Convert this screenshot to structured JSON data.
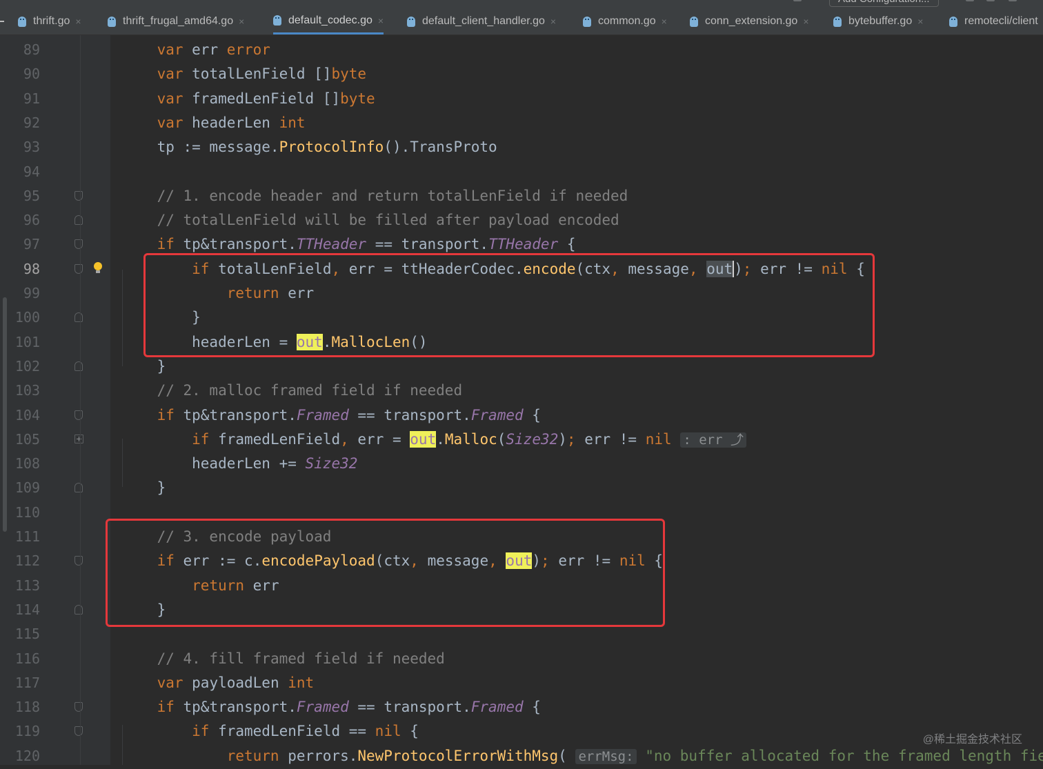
{
  "toolbar": {
    "run_config_label": "Add Configuration..."
  },
  "tabs": [
    {
      "label": "thrift.go",
      "active": false,
      "icon": "go-file-icon"
    },
    {
      "label": "thrift_frugal_amd64.go",
      "active": false,
      "icon": "go-file-icon"
    },
    {
      "label": "default_codec.go",
      "active": true,
      "icon": "go-file-icon"
    },
    {
      "label": "default_client_handler.go",
      "active": false,
      "icon": "go-file-icon"
    },
    {
      "label": "common.go",
      "active": false,
      "icon": "go-file-icon"
    },
    {
      "label": "conn_extension.go",
      "active": false,
      "icon": "go-file-icon"
    },
    {
      "label": "bytebuffer.go",
      "active": false,
      "icon": "go-file-icon"
    },
    {
      "label": "remotecli/client",
      "active": false,
      "icon": "go-file-icon"
    }
  ],
  "tab_close_glyph": "×",
  "editor": {
    "current_line": "98",
    "lines": [
      {
        "n": "89",
        "fold": "",
        "tokens": [
          [
            "",
            "    "
          ],
          [
            "kw",
            "var"
          ],
          [
            "",
            " err "
          ],
          [
            "ty",
            "error"
          ]
        ]
      },
      {
        "n": "90",
        "fold": "",
        "tokens": [
          [
            "",
            "    "
          ],
          [
            "kw",
            "var"
          ],
          [
            "",
            " totalLenField []"
          ],
          [
            "ty",
            "byte"
          ]
        ]
      },
      {
        "n": "91",
        "fold": "",
        "tokens": [
          [
            "",
            "    "
          ],
          [
            "kw",
            "var"
          ],
          [
            "",
            " framedLenField []"
          ],
          [
            "ty",
            "byte"
          ]
        ]
      },
      {
        "n": "92",
        "fold": "",
        "tokens": [
          [
            "",
            "    "
          ],
          [
            "kw",
            "var"
          ],
          [
            "",
            " headerLen "
          ],
          [
            "ty",
            "int"
          ]
        ]
      },
      {
        "n": "93",
        "fold": "",
        "tokens": [
          [
            "",
            "    tp := message."
          ],
          [
            "mt",
            "ProtocolInfo"
          ],
          [
            "",
            "().TransProto"
          ]
        ]
      },
      {
        "n": "94",
        "fold": "",
        "tokens": []
      },
      {
        "n": "95",
        "fold": "open",
        "tokens": [
          [
            "",
            "    "
          ],
          [
            "cm",
            "// 1. encode header and return totalLenField if needed"
          ]
        ]
      },
      {
        "n": "96",
        "fold": "close",
        "tokens": [
          [
            "",
            "    "
          ],
          [
            "cm",
            "// totalLenField will be filled after payload encoded"
          ]
        ]
      },
      {
        "n": "97",
        "fold": "open",
        "tokens": [
          [
            "",
            "    "
          ],
          [
            "kw",
            "if"
          ],
          [
            "",
            " tp&transport."
          ],
          [
            "it",
            "TTHeader"
          ],
          [
            "",
            " == transport."
          ],
          [
            "it",
            "TTHeader"
          ],
          [
            "",
            " {"
          ]
        ]
      },
      {
        "n": "98",
        "fold": "open",
        "bulb": true,
        "tokens": [
          [
            "",
            "        "
          ],
          [
            "kw",
            "if"
          ],
          [
            "",
            " totalLenField"
          ],
          [
            "kw",
            ","
          ],
          [
            "",
            " err = ttHeaderCodec."
          ],
          [
            "mt",
            "encode"
          ],
          [
            "",
            "(ctx"
          ],
          [
            "kw",
            ","
          ],
          [
            "",
            " message"
          ],
          [
            "kw",
            ","
          ],
          [
            "",
            " "
          ],
          [
            "sel",
            "out"
          ],
          [
            "caret",
            ")"
          ],
          [
            "kw",
            ";"
          ],
          [
            "",
            " err != "
          ],
          [
            "kw",
            "nil"
          ],
          [
            "",
            " {"
          ]
        ]
      },
      {
        "n": "99",
        "fold": "",
        "tokens": [
          [
            "",
            "            "
          ],
          [
            "kw",
            "return"
          ],
          [
            "",
            " err"
          ]
        ]
      },
      {
        "n": "100",
        "fold": "close",
        "tokens": [
          [
            "",
            "        }"
          ]
        ]
      },
      {
        "n": "101",
        "fold": "",
        "tokens": [
          [
            "",
            "        headerLen = "
          ],
          [
            "hl",
            "out"
          ],
          [
            "",
            "."
          ],
          [
            "mt",
            "MallocLen"
          ],
          [
            "",
            "()"
          ]
        ]
      },
      {
        "n": "102",
        "fold": "close",
        "tokens": [
          [
            "",
            "    }"
          ]
        ]
      },
      {
        "n": "103",
        "fold": "",
        "tokens": [
          [
            "",
            "    "
          ],
          [
            "cm",
            "// 2. malloc framed field if needed"
          ]
        ]
      },
      {
        "n": "104",
        "fold": "open",
        "tokens": [
          [
            "",
            "    "
          ],
          [
            "kw",
            "if"
          ],
          [
            "",
            " tp&transport."
          ],
          [
            "it",
            "Framed"
          ],
          [
            "",
            " == transport."
          ],
          [
            "it",
            "Framed"
          ],
          [
            "",
            " {"
          ]
        ]
      },
      {
        "n": "105",
        "fold": "plus",
        "tokens": [
          [
            "",
            "        "
          ],
          [
            "kw",
            "if"
          ],
          [
            "",
            " framedLenField"
          ],
          [
            "kw",
            ","
          ],
          [
            "",
            " err = "
          ],
          [
            "hl",
            "out"
          ],
          [
            "",
            "."
          ],
          [
            "mt",
            "Malloc"
          ],
          [
            "",
            "("
          ],
          [
            "it",
            "Size32"
          ],
          [
            "",
            ")"
          ],
          [
            "kw",
            ";"
          ],
          [
            "",
            " err != "
          ],
          [
            "kw",
            "nil"
          ],
          [
            "",
            " "
          ],
          [
            "hint",
            ": err ⤴"
          ]
        ]
      },
      {
        "n": "108",
        "fold": "",
        "tokens": [
          [
            "",
            "        headerLen += "
          ],
          [
            "it",
            "Size32"
          ]
        ]
      },
      {
        "n": "109",
        "fold": "close",
        "tokens": [
          [
            "",
            "    }"
          ]
        ]
      },
      {
        "n": "110",
        "fold": "",
        "tokens": []
      },
      {
        "n": "111",
        "fold": "",
        "tokens": [
          [
            "",
            "    "
          ],
          [
            "cm",
            "// 3. encode payload"
          ]
        ]
      },
      {
        "n": "112",
        "fold": "open",
        "tokens": [
          [
            "",
            "    "
          ],
          [
            "kw",
            "if"
          ],
          [
            "",
            " err := "
          ],
          [
            "pk",
            "c"
          ],
          [
            "",
            "."
          ],
          [
            "mt",
            "encodePayload"
          ],
          [
            "",
            "(ctx"
          ],
          [
            "kw",
            ","
          ],
          [
            "",
            " message"
          ],
          [
            "kw",
            ","
          ],
          [
            "",
            " "
          ],
          [
            "hl",
            "out"
          ],
          [
            "",
            ")"
          ],
          [
            "kw",
            ";"
          ],
          [
            "",
            " err != "
          ],
          [
            "kw",
            "nil"
          ],
          [
            "",
            " {"
          ]
        ]
      },
      {
        "n": "113",
        "fold": "",
        "tokens": [
          [
            "",
            "        "
          ],
          [
            "kw",
            "return"
          ],
          [
            "",
            " err"
          ]
        ]
      },
      {
        "n": "114",
        "fold": "close",
        "tokens": [
          [
            "",
            "    }"
          ]
        ]
      },
      {
        "n": "115",
        "fold": "",
        "tokens": []
      },
      {
        "n": "116",
        "fold": "",
        "tokens": [
          [
            "",
            "    "
          ],
          [
            "cm",
            "// 4. fill framed field if needed"
          ]
        ]
      },
      {
        "n": "117",
        "fold": "",
        "tokens": [
          [
            "",
            "    "
          ],
          [
            "kw",
            "var"
          ],
          [
            "",
            " payloadLen "
          ],
          [
            "ty",
            "int"
          ]
        ]
      },
      {
        "n": "118",
        "fold": "open",
        "tokens": [
          [
            "",
            "    "
          ],
          [
            "kw",
            "if"
          ],
          [
            "",
            " tp&transport."
          ],
          [
            "it",
            "Framed"
          ],
          [
            "",
            " == transport."
          ],
          [
            "it",
            "Framed"
          ],
          [
            "",
            " {"
          ]
        ]
      },
      {
        "n": "119",
        "fold": "open",
        "tokens": [
          [
            "",
            "        "
          ],
          [
            "kw",
            "if"
          ],
          [
            "",
            " framedLenField == "
          ],
          [
            "kw",
            "nil"
          ],
          [
            "",
            " {"
          ]
        ]
      },
      {
        "n": "120",
        "fold": "",
        "tokens": [
          [
            "",
            "            "
          ],
          [
            "kw",
            "return"
          ],
          [
            "",
            " perrors."
          ],
          [
            "mt",
            "NewProtocolErrorWithMsg"
          ],
          [
            "",
            "( "
          ],
          [
            "hint",
            "errMsg:"
          ],
          [
            "",
            " "
          ],
          [
            "st",
            "\"no buffer allocated for the framed length field\""
          ]
        ]
      }
    ]
  },
  "watermark": "@稀土掘金技术社区",
  "colors": {
    "highlight_box": "#e5383b",
    "usage_highlight": "#eff05a",
    "background": "#2b2b2b"
  }
}
